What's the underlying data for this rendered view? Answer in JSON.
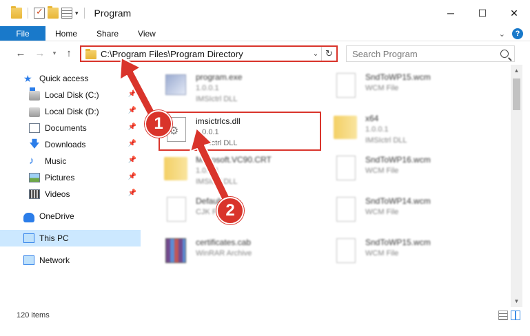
{
  "window": {
    "title": "Program",
    "controls": {
      "minimize": "─",
      "maximize": "☐",
      "close": "✕"
    }
  },
  "ribbon": {
    "tabs": [
      "File",
      "Home",
      "Share",
      "View"
    ]
  },
  "address": {
    "path": "C:\\Program Files\\Program Directory"
  },
  "search": {
    "placeholder": "Search Program"
  },
  "nav": {
    "quick_access": "Quick access",
    "items": [
      "Local Disk (C:)",
      "Local Disk (D:)",
      "Documents",
      "Downloads",
      "Music",
      "Pictures",
      "Videos"
    ],
    "onedrive": "OneDrive",
    "this_pc": "This PC",
    "network": "Network"
  },
  "files": [
    {
      "name": "program.exe",
      "meta1": "1.0.0.1",
      "meta2": "IMSIctrl DLL"
    },
    {
      "name": "SndToWP15.wcm",
      "meta1": "WCM File",
      "meta2": ""
    },
    {
      "name": "imsictrlcs.dll",
      "meta1": "1.0.0.1",
      "meta2": "IMSIctrl DLL"
    },
    {
      "name": "x64",
      "meta1": "1.0.0.1",
      "meta2": "IMSIctrl DLL"
    },
    {
      "name": "Microsoft.VC90.CRT",
      "meta1": "1.0.0.1",
      "meta2": "IMSIctrl DLL"
    },
    {
      "name": "SndToWP16.wcm",
      "meta1": "WCM File",
      "meta2": ""
    },
    {
      "name": "Default.cjk",
      "meta1": "CJK File",
      "meta2": ""
    },
    {
      "name": "SndToWP14.wcm",
      "meta1": "WCM File",
      "meta2": ""
    },
    {
      "name": "certificates.cab",
      "meta1": "WinRAR Archive",
      "meta2": ""
    },
    {
      "name": "SndToWP15.wcm",
      "meta1": "WCM File",
      "meta2": ""
    }
  ],
  "status": {
    "count": "120 items"
  },
  "annotations": {
    "badge1": "1",
    "badge2": "2"
  },
  "colors": {
    "accent": "#1979ca",
    "highlight": "#d9342b",
    "selection": "#cce8ff"
  }
}
